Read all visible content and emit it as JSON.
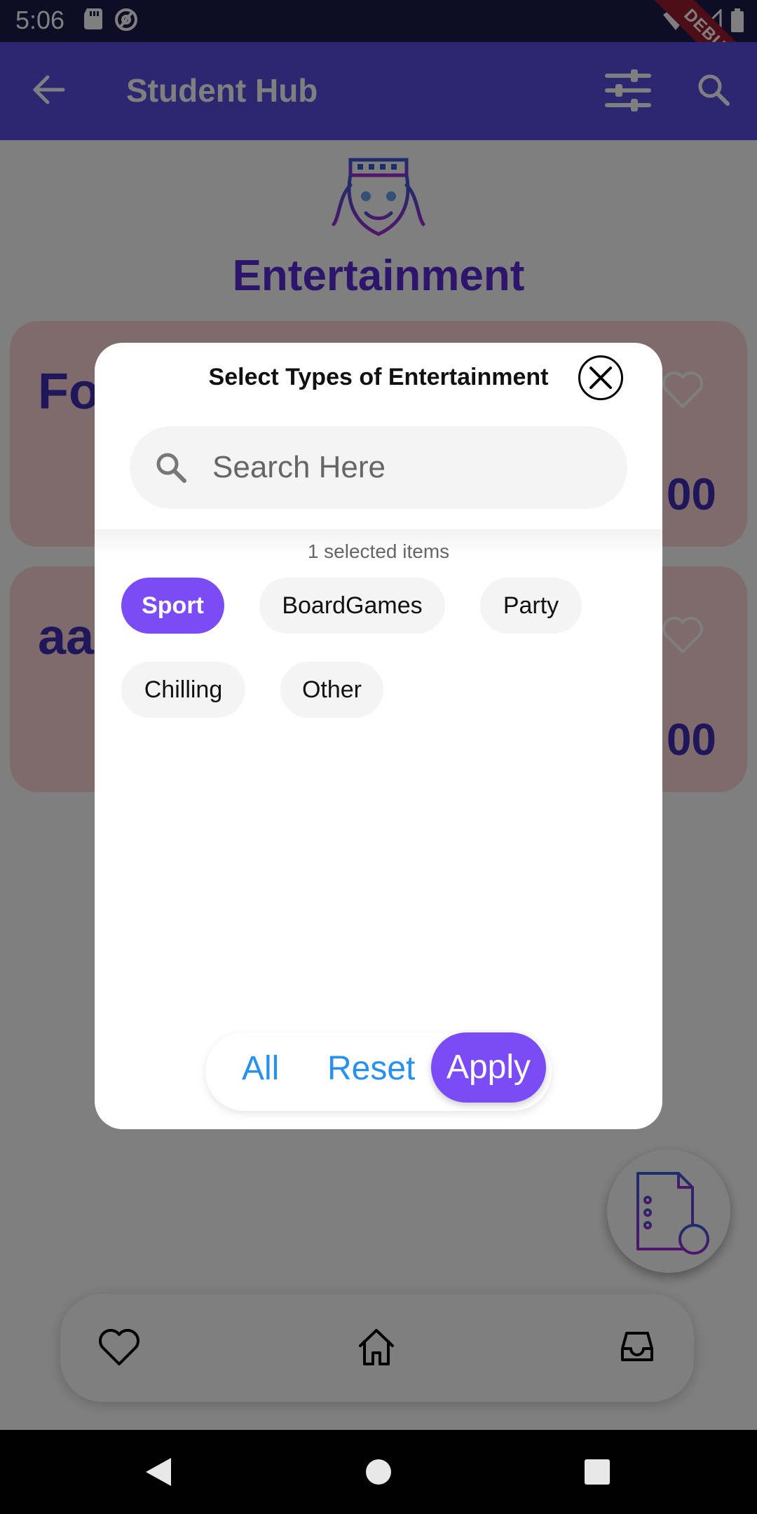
{
  "status_bar": {
    "time": "5:06",
    "debug_label": "DEBUG"
  },
  "app_bar": {
    "title": "Student Hub"
  },
  "category": {
    "title": "Entertainment"
  },
  "cards": [
    {
      "title_partial": "Fo",
      "price_partial": "00"
    },
    {
      "title_partial": "aa",
      "price_partial": "00"
    }
  ],
  "dialog": {
    "title": "Select Types of Entertainment",
    "search_placeholder": "Search Here",
    "selected_count_text": "1 selected items",
    "chips": [
      {
        "label": "Sport",
        "selected": true
      },
      {
        "label": "BoardGames",
        "selected": false
      },
      {
        "label": "Party",
        "selected": false
      },
      {
        "label": "Chilling",
        "selected": false
      },
      {
        "label": "Other",
        "selected": false
      }
    ],
    "actions": {
      "all": "All",
      "reset": "Reset",
      "apply": "Apply"
    }
  },
  "colors": {
    "app_bar": "#5b4de0",
    "accent_purple": "#7b4cf5",
    "link_blue": "#2591f0",
    "card_bg": "#ffd6d6",
    "title_purple": "#5b2bd6"
  },
  "icons": {
    "back": "arrow-left-icon",
    "filter": "sliders-icon",
    "search": "search-icon",
    "close": "close-circle-icon",
    "fab": "document-add-icon",
    "nav": [
      "heart-icon",
      "home-icon",
      "inbox-icon"
    ]
  }
}
